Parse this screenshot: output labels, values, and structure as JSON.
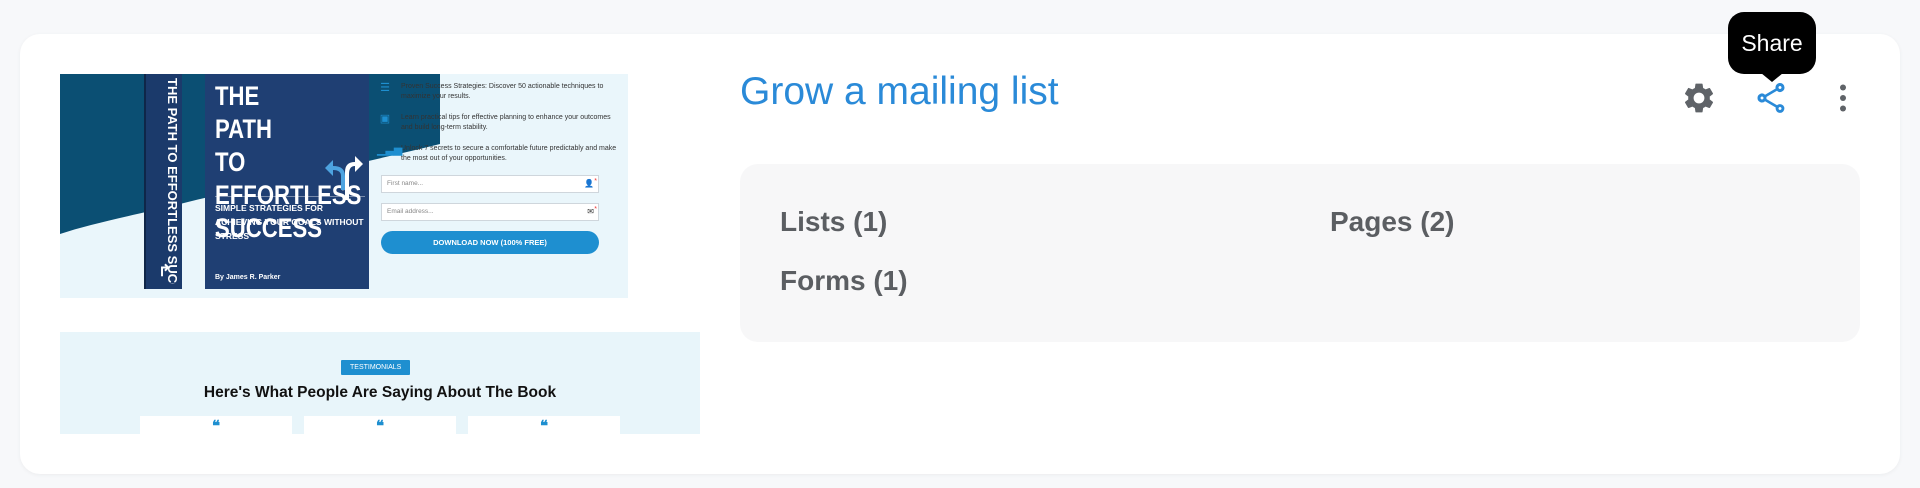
{
  "funnel": {
    "title": "Grow a mailing list",
    "tooltip": "Share",
    "icons": {
      "settings": "gear-icon",
      "share": "share-icon",
      "more": "more-vert-icon"
    },
    "stats": {
      "lists": "Lists (1)",
      "pages": "Pages (2)",
      "forms": "Forms (1)"
    }
  },
  "preview": {
    "book": {
      "spine_title": "THE PATH TO EFFORTLESS SUCCESS",
      "cover_title": "THE PATH TO EFFORTLESS SUCCESS",
      "cover_subtitle": "SIMPLE STRATEGIES FOR ACHIEVING YOUR GOALS WITHOUT STRESS",
      "author": "By James R. Parker"
    },
    "features": [
      {
        "icon": "list-icon",
        "text": "Proven Success Strategies: Discover 50 actionable techniques to maximize your results."
      },
      {
        "icon": "money-icon",
        "text": "Learn practical tips for effective planning to enhance your outcomes and build long-term stability."
      },
      {
        "icon": "bar-chart-icon",
        "text": "Unlock 7 secrets to secure a comfortable future predictably and make the most out of your opportunities."
      }
    ],
    "form": {
      "first_name_placeholder": "First name...",
      "email_placeholder": "Email address...",
      "button_label": "DOWNLOAD NOW (100% FREE)"
    },
    "testimonials": {
      "badge": "TESTIMONIALS",
      "title": "Here's What People Are Saying About The Book",
      "quote_mark": "❝"
    },
    "colors": {
      "brand_blue": "#1e8fd0",
      "dark_navy": "#0b4f73"
    }
  }
}
